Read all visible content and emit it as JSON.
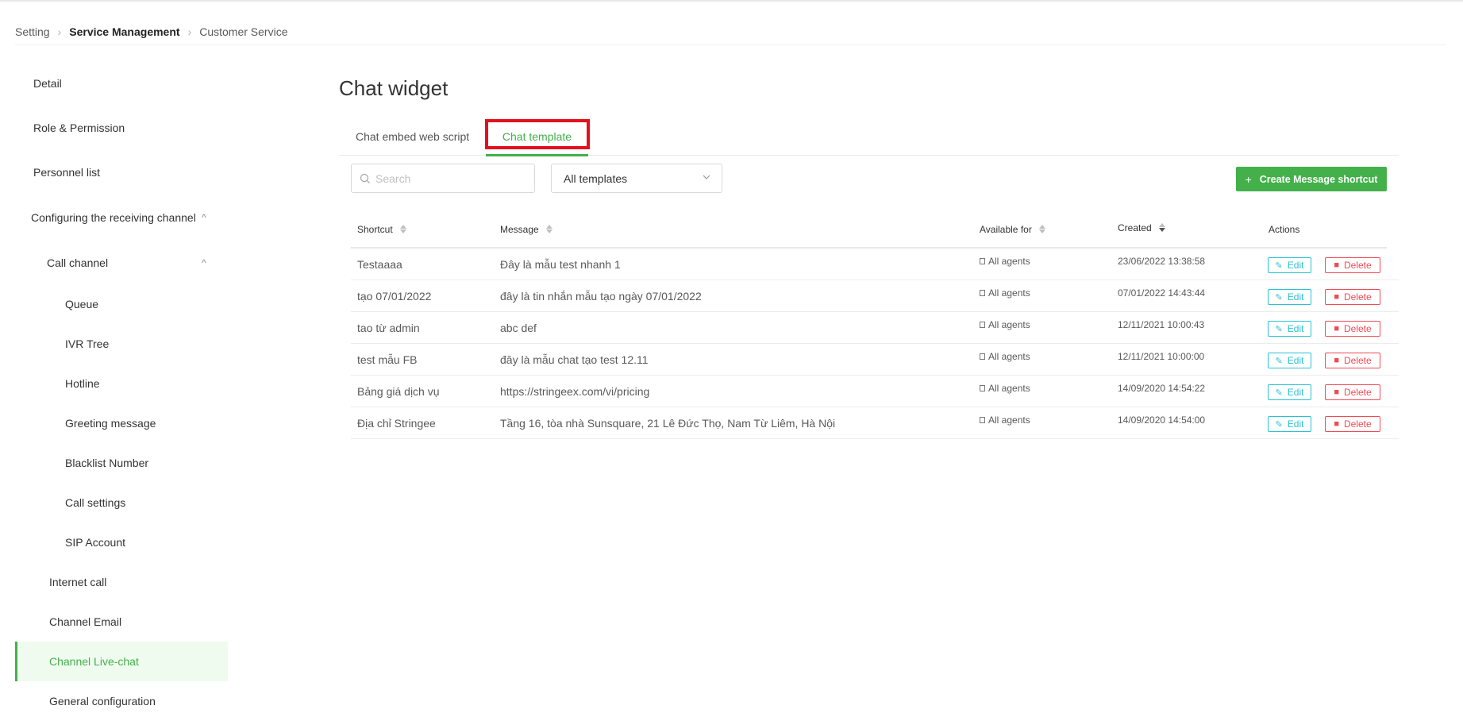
{
  "breadcrumb": {
    "items": [
      "Setting",
      "Service Management",
      "Customer Service"
    ]
  },
  "sidebar": {
    "items": [
      {
        "label": "Detail"
      },
      {
        "label": "Role & Permission"
      },
      {
        "label": "Personnel list"
      },
      {
        "label": "Configuring the receiving channel",
        "expanded": true
      },
      {
        "label": "Call channel",
        "expanded": true
      },
      {
        "label": "Queue"
      },
      {
        "label": "IVR Tree"
      },
      {
        "label": "Hotline"
      },
      {
        "label": "Greeting message"
      },
      {
        "label": "Blacklist Number"
      },
      {
        "label": "Call settings"
      },
      {
        "label": "SIP Account"
      },
      {
        "label": "Internet call"
      },
      {
        "label": "Channel Email"
      },
      {
        "label": "Channel Live-chat",
        "active": true
      },
      {
        "label": "General configuration"
      }
    ]
  },
  "main": {
    "title": "Chat widget",
    "tabs": [
      {
        "label": "Chat embed web script"
      },
      {
        "label": "Chat template",
        "active": true
      }
    ],
    "search": {
      "placeholder": "Search",
      "value": ""
    },
    "filter": {
      "selected": "All templates"
    },
    "create_button": {
      "plus": "+",
      "label": "Create Message shortcut"
    }
  },
  "table": {
    "headers": [
      "Shortcut",
      "Message",
      "Available for",
      "Created",
      "Actions"
    ],
    "edit_label": "Edit",
    "delete_label": "Delete",
    "rows": [
      {
        "shortcut": "Testaaaa",
        "message": "Đây là mẫu test nhanh 1",
        "available": "All agents",
        "created": "23/06/2022 13:38:58"
      },
      {
        "shortcut": "tạo 07/01/2022",
        "message": "đây là tin nhắn mẫu tạo ngày 07/01/2022",
        "available": "All agents",
        "created": "07/01/2022 14:43:44"
      },
      {
        "shortcut": "tao từ admin",
        "message": "abc def",
        "available": "All agents",
        "created": "12/11/2021 10:00:43"
      },
      {
        "shortcut": "test mẫu FB",
        "message": "đây là mẫu chat tạo test 12.11",
        "available": "All agents",
        "created": "12/11/2021 10:00:00"
      },
      {
        "shortcut": "Bảng giá dịch vụ",
        "message": "https://stringeex.com/vi/pricing",
        "available": "All agents",
        "created": "14/09/2020 14:54:22"
      },
      {
        "shortcut": "Địa chỉ Stringee",
        "message": "Tầng 16, tòa nhà Sunsquare, 21 Lê Đức Thọ, Nam Từ Liêm, Hà Nội",
        "available": "All agents",
        "created": "14/09/2020 14:54:00"
      }
    ]
  },
  "colors": {
    "accent": "#43b04a",
    "edit": "#29c2d4",
    "delete": "#f04a55",
    "highlight": "#e5101c"
  }
}
